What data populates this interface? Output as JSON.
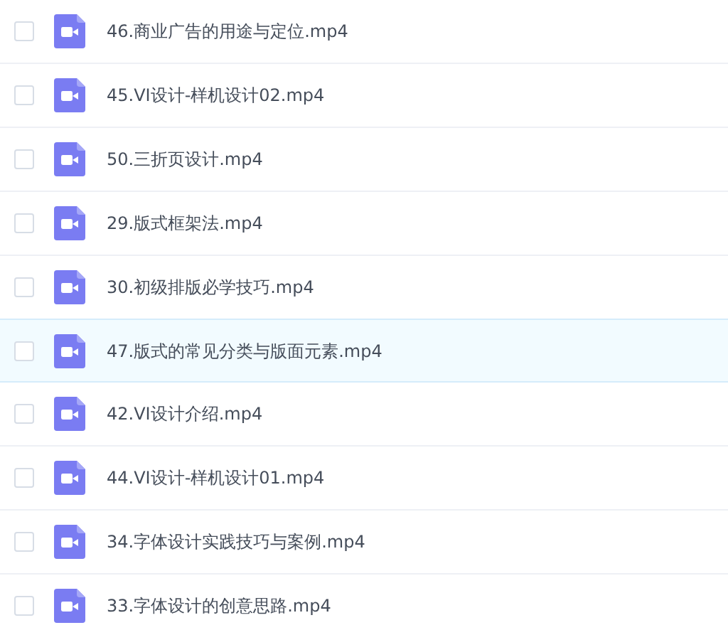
{
  "files": [
    {
      "name": "46.商业广告的用途与定位.mp4",
      "checked": false,
      "selected": false
    },
    {
      "name": "45.VI设计-样机设计02.mp4",
      "checked": false,
      "selected": false
    },
    {
      "name": "50.三折页设计.mp4",
      "checked": false,
      "selected": false
    },
    {
      "name": "29.版式框架法.mp4",
      "checked": false,
      "selected": false
    },
    {
      "name": "30.初级排版必学技巧.mp4",
      "checked": false,
      "selected": false
    },
    {
      "name": "47.版式的常见分类与版面元素.mp4",
      "checked": false,
      "selected": true
    },
    {
      "name": "42.VI设计介绍.mp4",
      "checked": false,
      "selected": false
    },
    {
      "name": "44.VI设计-样机设计01.mp4",
      "checked": false,
      "selected": false
    },
    {
      "name": "34.字体设计实践技巧与案例.mp4",
      "checked": false,
      "selected": false
    },
    {
      "name": "33.字体设计的创意思路.mp4",
      "checked": false,
      "selected": false
    }
  ]
}
